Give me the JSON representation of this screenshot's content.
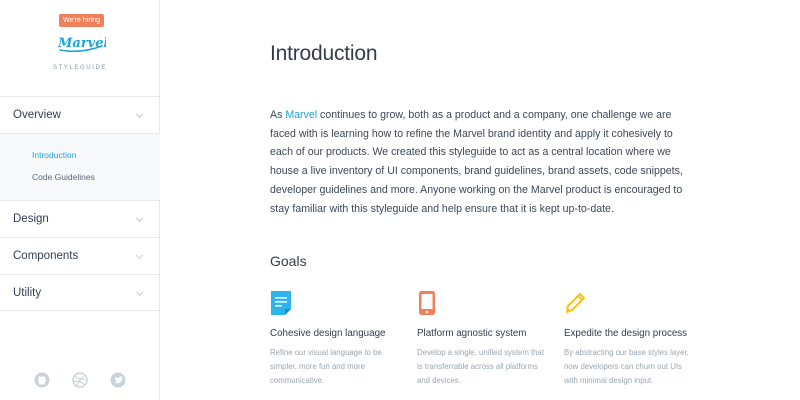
{
  "brand": {
    "hiring_badge": "We're hiring",
    "logo_text": "Marvel",
    "subtitle": "STYLEGUIDE"
  },
  "sidebar": {
    "items": [
      {
        "label": "Overview",
        "expanded": true
      },
      {
        "label": "Design"
      },
      {
        "label": "Components"
      },
      {
        "label": "Utility"
      }
    ],
    "subitems": [
      {
        "label": "Introduction",
        "active": true
      },
      {
        "label": "Code Guidelines"
      }
    ],
    "social": [
      "github-icon",
      "dribbble-icon",
      "twitter-icon"
    ]
  },
  "main": {
    "title": "Introduction",
    "intro_before_link": "As ",
    "intro_link": "Marvel",
    "intro_after_link": " continues to grow, both as a product and a company, one challenge we are faced with is learning how to refine the Marvel brand identity and apply it cohesively to each of our products. We created this styleguide to act as a central location where we house a live inventory of UI components, brand guidelines, brand assets, code snippets, developer guidelines and more. Anyone working on the Marvel product is encouraged to stay familiar with this styleguide and help ensure that it is kept up-to-date.",
    "goals_title": "Goals",
    "goals": [
      {
        "icon": "document-icon",
        "title": "Cohesive design language",
        "text": "Refine our visual language to be simpler, more fun and more communicative."
      },
      {
        "icon": "phone-icon",
        "title": "Platform agnostic system",
        "text": "Develop a single, unified system that is transferrable across all platforms and devices."
      },
      {
        "icon": "pencil-icon",
        "title": "Expedite the design process",
        "text": "By abstracting our base styles layer, now developers can churn out UIs with minimal design input."
      }
    ]
  },
  "colors": {
    "accent": "#1ea4d8",
    "badge": "#f0805c",
    "document_icon": "#2db4ec",
    "phone_icon": "#f0805c",
    "pencil_icon": "#f5c42b"
  }
}
